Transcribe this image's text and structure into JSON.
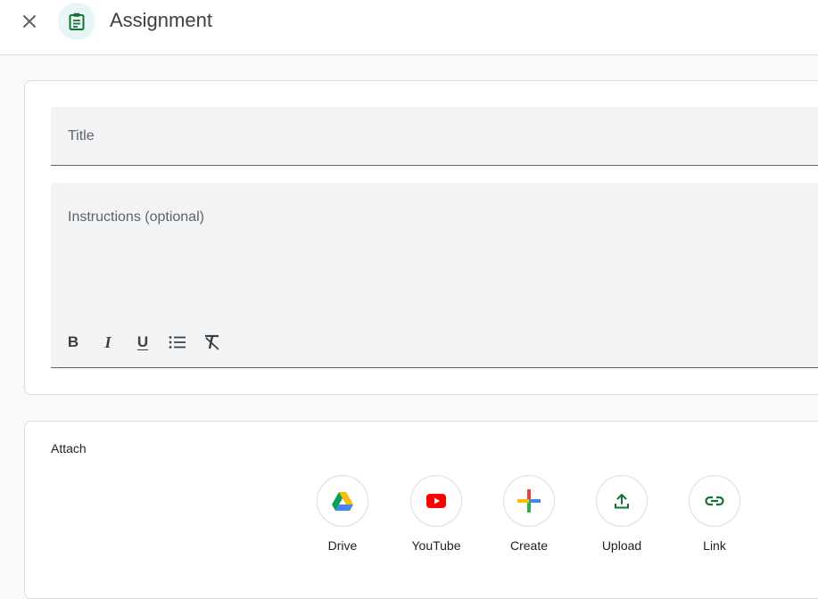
{
  "header": {
    "title": "Assignment",
    "close_icon": "close-icon",
    "type_icon": "assignment-icon"
  },
  "form": {
    "title_placeholder": "Title",
    "instructions_placeholder": "Instructions (optional)",
    "toolbar": [
      {
        "name": "bold",
        "label": "B"
      },
      {
        "name": "italic",
        "label": "I"
      },
      {
        "name": "underline",
        "label": "U"
      },
      {
        "name": "bulleted-list",
        "icon": "list-icon"
      },
      {
        "name": "clear-formatting",
        "icon": "clear-format-icon"
      }
    ]
  },
  "attach": {
    "label": "Attach",
    "items": [
      {
        "label": "Drive",
        "icon": "google-drive-icon"
      },
      {
        "label": "YouTube",
        "icon": "youtube-icon"
      },
      {
        "label": "Create",
        "icon": "create-plus-icon"
      },
      {
        "label": "Upload",
        "icon": "upload-icon"
      },
      {
        "label": "Link",
        "icon": "link-icon"
      }
    ]
  },
  "colors": {
    "accent": "#1967d2",
    "teal": "#137333",
    "youtube_red": "#ff0000",
    "type_icon_bg": "#e8f4f8",
    "type_icon_fg": "#1e8e3e"
  }
}
